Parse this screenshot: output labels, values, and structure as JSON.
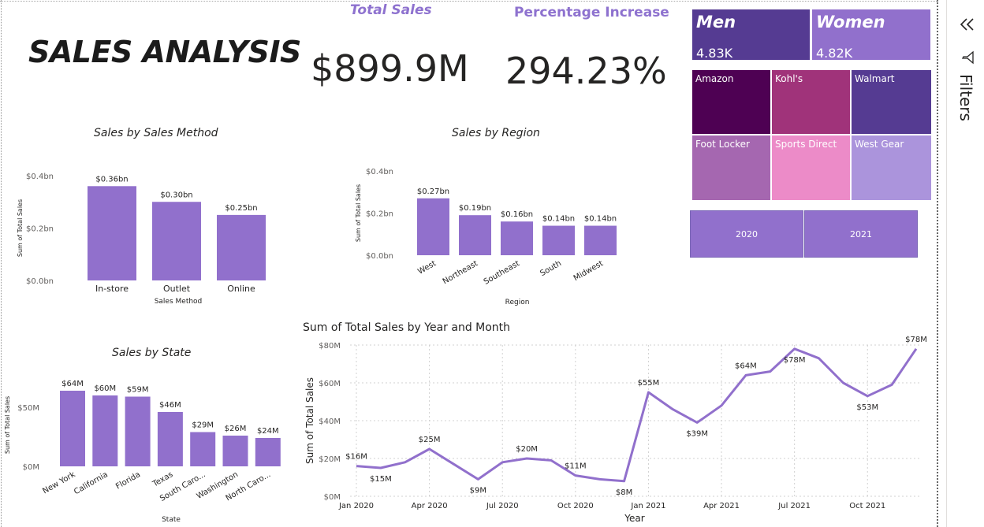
{
  "header": {
    "title": "SALES ANALYSIS"
  },
  "kpis": {
    "total_sales": {
      "label": "Total Sales",
      "value": "$899.9M"
    },
    "pct_increase": {
      "label": "Percentage Increase",
      "value": "294.23%"
    }
  },
  "gender": {
    "men": {
      "label": "Men",
      "value": "4.83K",
      "color": "#553b92"
    },
    "women": {
      "label": "Women",
      "value": "4.82K",
      "color": "#9170cc"
    }
  },
  "retailers": [
    {
      "name": "Amazon",
      "color": "#4e0153"
    },
    {
      "name": "Kohl's",
      "color": "#a0337a"
    },
    {
      "name": "Walmart",
      "color": "#553b92"
    },
    {
      "name": "Foot Locker",
      "color": "#a567b0"
    },
    {
      "name": "Sports Direct",
      "color": "#ec8bc8"
    },
    {
      "name": "West Gear",
      "color": "#ab94dc"
    }
  ],
  "year_slicer": [
    "2020",
    "2021"
  ],
  "filters_pane": {
    "label": "Filters",
    "collapse_icon": "double-chevron-left-icon",
    "filter_icon": "funnel-icon"
  },
  "chart_data": [
    {
      "type": "bar",
      "title": "Sales by Sales Method",
      "xlabel": "Sales Method",
      "ylabel": "Sum of Total Sales",
      "categories": [
        "In-store",
        "Outlet",
        "Online"
      ],
      "values": [
        0.36,
        0.3,
        0.25
      ],
      "data_labels": [
        "$0.36bn",
        "$0.30bn",
        "$0.25bn"
      ],
      "yticks": [
        "$0.0bn",
        "$0.2bn",
        "$0.4bn"
      ],
      "ylim": [
        0,
        0.4
      ],
      "color": "#9170cc"
    },
    {
      "type": "bar",
      "title": "Sales by Region",
      "xlabel": "Region",
      "ylabel": "Sum of Total Sales",
      "categories": [
        "West",
        "Northeast",
        "Southeast",
        "South",
        "Midwest"
      ],
      "values": [
        0.27,
        0.19,
        0.16,
        0.14,
        0.14
      ],
      "data_labels": [
        "$0.27bn",
        "$0.19bn",
        "$0.16bn",
        "$0.14bn",
        "$0.14bn"
      ],
      "yticks": [
        "$0.0bn",
        "$0.2bn",
        "$0.4bn"
      ],
      "ylim": [
        0,
        0.4
      ],
      "color": "#9170cc"
    },
    {
      "type": "bar",
      "title": "Sales by State",
      "xlabel": "State",
      "ylabel": "Sum of Total Sales",
      "categories": [
        "New York",
        "California",
        "Florida",
        "Texas",
        "South Caro...",
        "Washington",
        "North Caro..."
      ],
      "values": [
        64,
        60,
        59,
        46,
        29,
        26,
        24
      ],
      "data_labels": [
        "$64M",
        "$60M",
        "$59M",
        "$46M",
        "$29M",
        "$26M",
        "$24M"
      ],
      "yticks": [
        "$0M",
        "$50M"
      ],
      "ylim": [
        0,
        70
      ],
      "color": "#9170cc"
    },
    {
      "type": "line",
      "title": "Sum of Total Sales by Year and Month",
      "xlabel": "Year",
      "ylabel": "Sum of Total Sales",
      "x": [
        "Jan 2020",
        "Feb 2020",
        "Mar 2020",
        "Apr 2020",
        "May 2020",
        "Jun 2020",
        "Jul 2020",
        "Aug 2020",
        "Sep 2020",
        "Oct 2020",
        "Nov 2020",
        "Dec 2020",
        "Jan 2021",
        "Feb 2021",
        "Mar 2021",
        "Apr 2021",
        "May 2021",
        "Jun 2021",
        "Jul 2021",
        "Aug 2021",
        "Sep 2021",
        "Oct 2021",
        "Nov 2021",
        "Dec 2021"
      ],
      "values": [
        16,
        15,
        18,
        25,
        17,
        9,
        18,
        20,
        19,
        11,
        9,
        8,
        55,
        46,
        39,
        48,
        64,
        66,
        78,
        73,
        60,
        53,
        59,
        78
      ],
      "xticks": [
        "Jan 2020",
        "Apr 2020",
        "Jul 2020",
        "Oct 2020",
        "Jan 2021",
        "Apr 2021",
        "Jul 2021",
        "Oct 2021"
      ],
      "yticks": [
        "$0M",
        "$20M",
        "$40M",
        "$60M",
        "$80M"
      ],
      "ylim": [
        0,
        80
      ],
      "grid": true,
      "color": "#9170cc",
      "point_labels": [
        {
          "index": 0,
          "text": "$16M",
          "pos": "above"
        },
        {
          "index": 1,
          "text": "$15M",
          "pos": "below"
        },
        {
          "index": 3,
          "text": "$25M",
          "pos": "above"
        },
        {
          "index": 5,
          "text": "$9M",
          "pos": "below"
        },
        {
          "index": 7,
          "text": "$20M",
          "pos": "above"
        },
        {
          "index": 9,
          "text": "$11M",
          "pos": "above"
        },
        {
          "index": 11,
          "text": "$8M",
          "pos": "below"
        },
        {
          "index": 12,
          "text": "$55M",
          "pos": "above"
        },
        {
          "index": 14,
          "text": "$39M",
          "pos": "below"
        },
        {
          "index": 16,
          "text": "$64M",
          "pos": "above"
        },
        {
          "index": 18,
          "text": "$78M",
          "pos": "below"
        },
        {
          "index": 21,
          "text": "$53M",
          "pos": "below"
        },
        {
          "index": 23,
          "text": "$78M",
          "pos": "above"
        }
      ]
    }
  ]
}
